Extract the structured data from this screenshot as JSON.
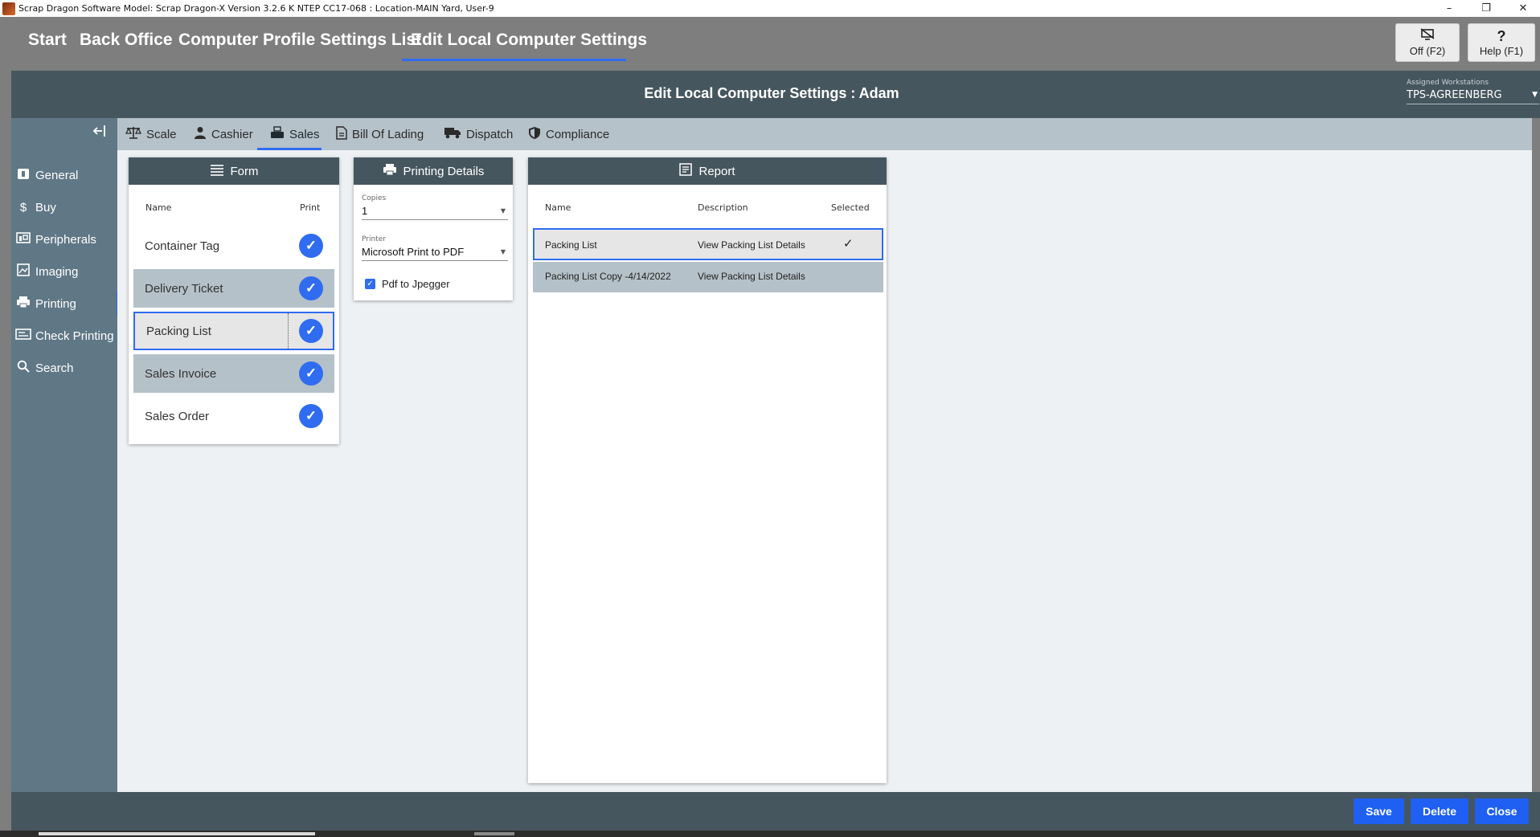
{
  "window": {
    "title": "Scrap Dragon Software Model: Scrap Dragon-X Version 3.2.6 K NTEP CC17-068 : Location-MAIN Yard, User-9",
    "minimize": "–",
    "restore": "❐",
    "close": "✕"
  },
  "topnav": {
    "breadcrumbs": [
      "Start",
      "Back Office",
      "Computer Profile Settings List",
      "Edit Local Computer Settings"
    ],
    "off_label": "Off (F2)",
    "help_label": "Help (F1)"
  },
  "header": {
    "title": "Edit Local Computer Settings :  Adam",
    "workstations_label": "Assigned Workstations",
    "workstations_value": "TPS-AGREENBERG"
  },
  "sidebar": {
    "items": [
      {
        "label": "General",
        "icon": "general-icon"
      },
      {
        "label": "Buy",
        "icon": "dollar-icon"
      },
      {
        "label": "Peripherals",
        "icon": "peripherals-icon"
      },
      {
        "label": "Imaging",
        "icon": "image-icon"
      },
      {
        "label": "Printing",
        "icon": "printer-icon"
      },
      {
        "label": "Check Printing",
        "icon": "check-printing-icon"
      },
      {
        "label": "Search",
        "icon": "search-icon"
      }
    ],
    "active": "Printing"
  },
  "tabs": {
    "items": [
      {
        "label": "Scale",
        "icon": "scale-icon"
      },
      {
        "label": "Cashier",
        "icon": "person-icon"
      },
      {
        "label": "Sales",
        "icon": "sales-icon"
      },
      {
        "label": "Bill Of Lading",
        "icon": "document-icon"
      },
      {
        "label": "Dispatch",
        "icon": "truck-icon"
      },
      {
        "label": "Compliance",
        "icon": "shield-icon"
      }
    ],
    "active": "Sales"
  },
  "form_card": {
    "title": "Form",
    "col_name": "Name",
    "col_print": "Print",
    "rows": [
      {
        "name": "Container Tag",
        "print": true,
        "state": "normal"
      },
      {
        "name": "Delivery Ticket",
        "print": true,
        "state": "shaded"
      },
      {
        "name": "Packing List",
        "print": true,
        "state": "selected"
      },
      {
        "name": "Sales Invoice",
        "print": true,
        "state": "shaded"
      },
      {
        "name": "Sales Order",
        "print": true,
        "state": "normal"
      }
    ]
  },
  "printing_card": {
    "title": "Printing Details",
    "copies_label": "Copies",
    "copies_value": "1",
    "printer_label": "Printer",
    "printer_value": "Microsoft Print to PDF",
    "pdf_checkbox_label": "Pdf to Jpegger",
    "pdf_checked": true
  },
  "report_card": {
    "title": "Report",
    "col_name": "Name",
    "col_description": "Description",
    "col_selected": "Selected",
    "rows": [
      {
        "name": "Packing List",
        "description": "View Packing List Details",
        "selected": true
      },
      {
        "name": "Packing List Copy -4/14/2022",
        "description": "View Packing List Details",
        "selected": false
      }
    ],
    "check_glyph": "✓"
  },
  "footer": {
    "save": "Save",
    "delete": "Delete",
    "close": "Close"
  },
  "colors": {
    "accent": "#2f6cf0",
    "button": "#1f5ff2",
    "header_band": "#46565f",
    "sidebar": "#607886"
  }
}
